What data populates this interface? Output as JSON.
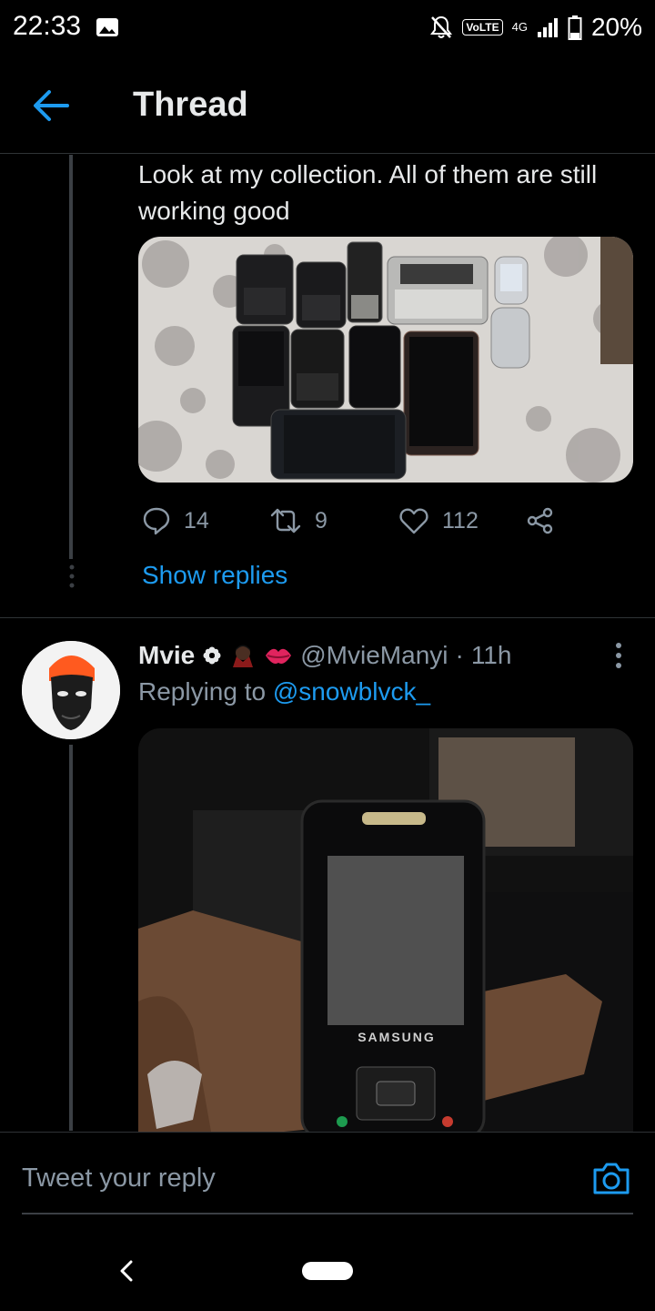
{
  "status_bar": {
    "time": "22:33",
    "volte": "VoLTE",
    "network": "4G",
    "battery": "20%"
  },
  "header": {
    "title": "Thread"
  },
  "tweet1": {
    "text": "Look at my collection. All of them are still working good",
    "stats": {
      "replies": "14",
      "retweets": "9",
      "likes": "112"
    },
    "show_replies": "Show replies"
  },
  "tweet2": {
    "name": "Mvie",
    "handle": "@MvieManyi",
    "separator": "·",
    "time": "11h",
    "replying_prefix": "Replying to",
    "replying_to": "@snowblvck_",
    "phone_brand": "SAMSUNG"
  },
  "compose": {
    "placeholder": "Tweet your reply"
  },
  "colors": {
    "accent": "#1d9bf0",
    "background": "#000000",
    "muted_text": "#8b98a5"
  }
}
